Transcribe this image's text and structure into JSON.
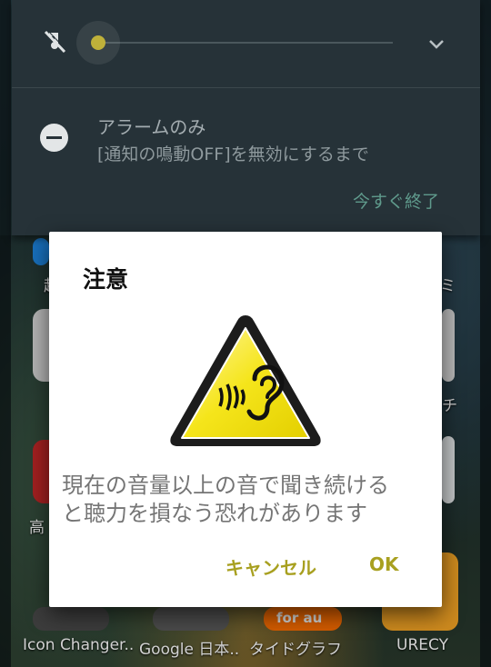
{
  "quick_settings": {
    "volume_level": 0.0,
    "dnd_mode_title": "アラームのみ",
    "dnd_mode_subtitle": "[通知の鳴動OFF]を無効にするまで",
    "end_now_label": "今すぐ終了",
    "mute_icon": "ringer-off-icon",
    "expand_icon": "chevron-down-icon",
    "dnd_icon": "do-not-disturb-icon"
  },
  "dialog": {
    "title": "注意",
    "icon": "hearing-warning-icon",
    "message_line1": "現在の音量以上の音で聞き続ける",
    "message_line2": "と聴力を損なう恐れがあります",
    "cancel_label": "キャンセル",
    "ok_label": "OK"
  },
  "home_screen": {
    "app_labels": [
      "Icon Changer..",
      "Google 日本..",
      "タイドグラフ",
      "URECY"
    ],
    "partial_labels": [
      "起",
      "ミ",
      "チ",
      "高"
    ],
    "badge_text": "for au"
  },
  "colors": {
    "shade_bg": "#263238",
    "accent_teal": "#5f9a8c",
    "dialog_button": "#a8a020",
    "warning_yellow": "#f5e51b"
  }
}
